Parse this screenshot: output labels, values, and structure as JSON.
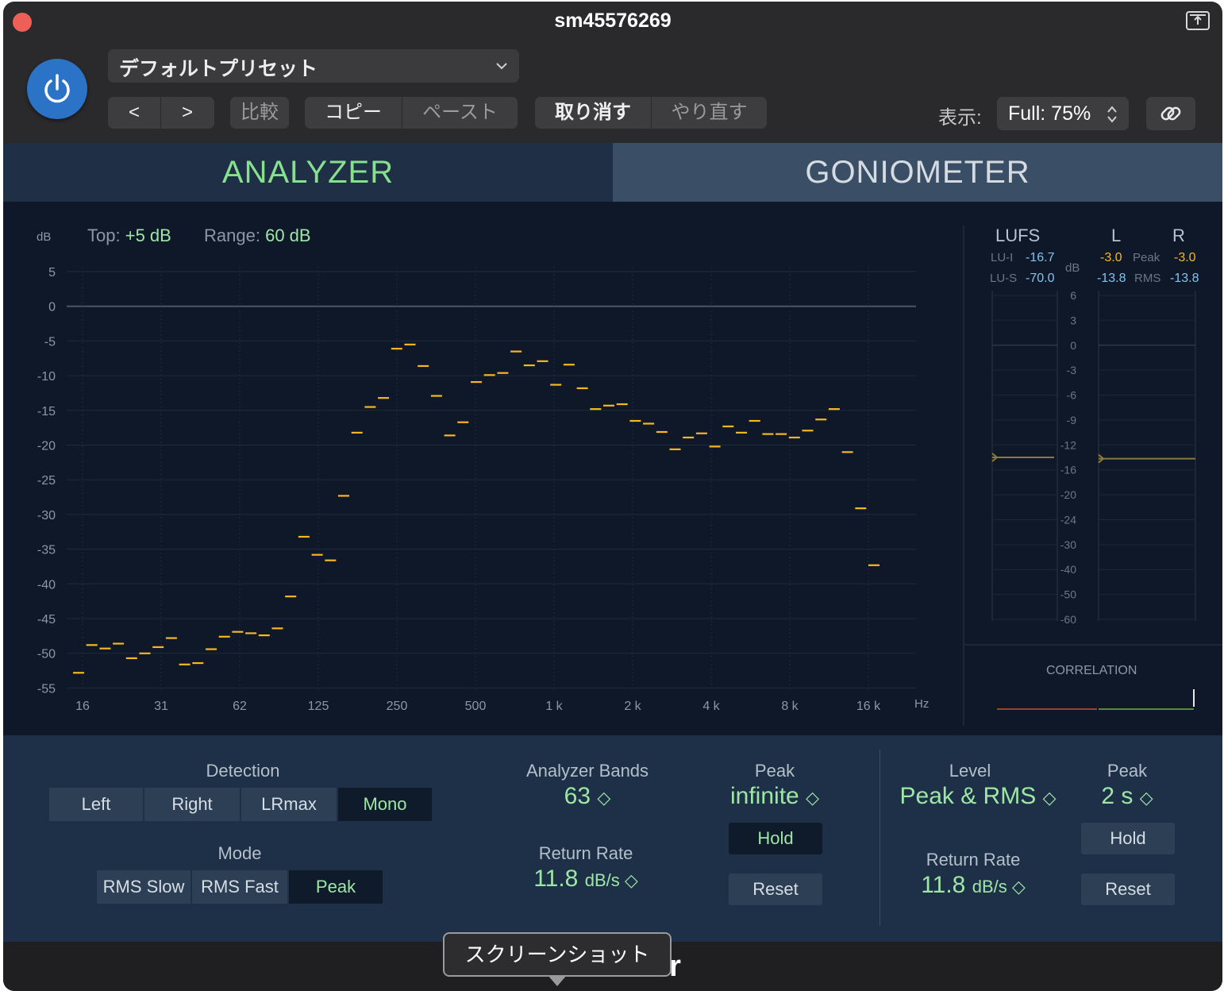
{
  "window": {
    "title": "sm45576269"
  },
  "toolbar": {
    "preset": "デフォルトプリセット",
    "back": "<",
    "forward": ">",
    "compare": "比較",
    "copy": "コピー",
    "paste": "ペースト",
    "undo": "取り消す",
    "redo": "やり直す",
    "view_label": "表示:",
    "view_value": "Full: 75%"
  },
  "tabs": {
    "analyzer": "ANALYZER",
    "goniometer": "GONIOMETER"
  },
  "analyzer": {
    "db_unit": "dB",
    "top_label": "Top:",
    "top_value": "+5 dB",
    "range_label": "Range:",
    "range_value": "60 dB",
    "hz_unit": "Hz",
    "y_ticks": [
      "5",
      "0",
      "-5",
      "-10",
      "-15",
      "-20",
      "-25",
      "-30",
      "-35",
      "-40",
      "-45",
      "-50",
      "-55"
    ],
    "x_ticks": [
      "16",
      "31",
      "62",
      "125",
      "250",
      "500",
      "1 k",
      "2 k",
      "4 k",
      "8 k",
      "16 k"
    ],
    "bar_color": "#f5b821",
    "band_levels_db": [
      -52.8,
      -48.8,
      -49.3,
      -48.6,
      -50.7,
      -50.0,
      -49.1,
      -47.8,
      -51.6,
      -51.4,
      -49.4,
      -47.6,
      -46.9,
      -47.1,
      -47.4,
      -46.4,
      -41.8,
      -33.2,
      -35.8,
      -36.6,
      -27.3,
      -18.2,
      -14.5,
      -13.2,
      -6.1,
      -5.5,
      -8.6,
      -12.9,
      -18.6,
      -16.7,
      -10.9,
      -9.9,
      -9.6,
      -6.5,
      -8.5,
      -7.9,
      -11.3,
      -8.4,
      -11.8,
      -14.8,
      -14.3,
      -14.1,
      -16.5,
      -16.9,
      -18.1,
      -20.6,
      -18.9,
      -18.3,
      -20.2,
      -17.3,
      -18.2,
      -16.5,
      -18.4,
      -18.4,
      -18.9,
      -17.9,
      -16.3,
      -14.8,
      -21.0,
      -29.1,
      -37.3
    ]
  },
  "meters": {
    "lufs_label": "LUFS",
    "l_label": "L",
    "r_label": "R",
    "lui_label": "LU-I",
    "lui_value": "-16.7",
    "lus_label": "LU-S",
    "lus_value": "-70.0",
    "db_label": "dB",
    "l_peak": "-3.0",
    "peak_label": "Peak",
    "r_peak": "-3.0",
    "l_rms": "-13.8",
    "rms_label": "RMS",
    "r_rms": "-13.8",
    "scale": [
      "6",
      "3",
      "0",
      "-3",
      "-6",
      "-9",
      "-12",
      "-16",
      "-20",
      "-24",
      "-30",
      "-40",
      "-50",
      "-60"
    ],
    "correlation_label": "CORRELATION"
  },
  "controls": {
    "detection_label": "Detection",
    "detection_options": [
      "Left",
      "Right",
      "LRmax",
      "Mono"
    ],
    "mode_label": "Mode",
    "mode_options": [
      "RMS Slow",
      "RMS Fast",
      "Peak"
    ],
    "bands_label": "Analyzer Bands",
    "bands_value": "63",
    "return_rate_label": "Return Rate",
    "return_rate_value": "11.8",
    "return_rate_unit": "dB/s",
    "peak_label": "Peak",
    "peak_value": "infinite",
    "hold": "Hold",
    "reset": "Reset",
    "level_label": "Level",
    "level_value": "Peak & RMS",
    "level_return_rate_label": "Return Rate",
    "level_return_rate_value": "11.8",
    "level_return_rate_unit": "dB/s",
    "level_peak_label": "Peak",
    "level_peak_value": "2 s",
    "level_hold": "Hold",
    "level_reset": "Reset"
  },
  "footer": {
    "visible_text": "er",
    "tooltip": "スクリーンショット"
  },
  "colors": {
    "accent_green": "#9ee6a5",
    "power_blue": "#2a73c6",
    "meter_yellow": "#f5b821",
    "meter_blue": "#7ec4f2"
  }
}
